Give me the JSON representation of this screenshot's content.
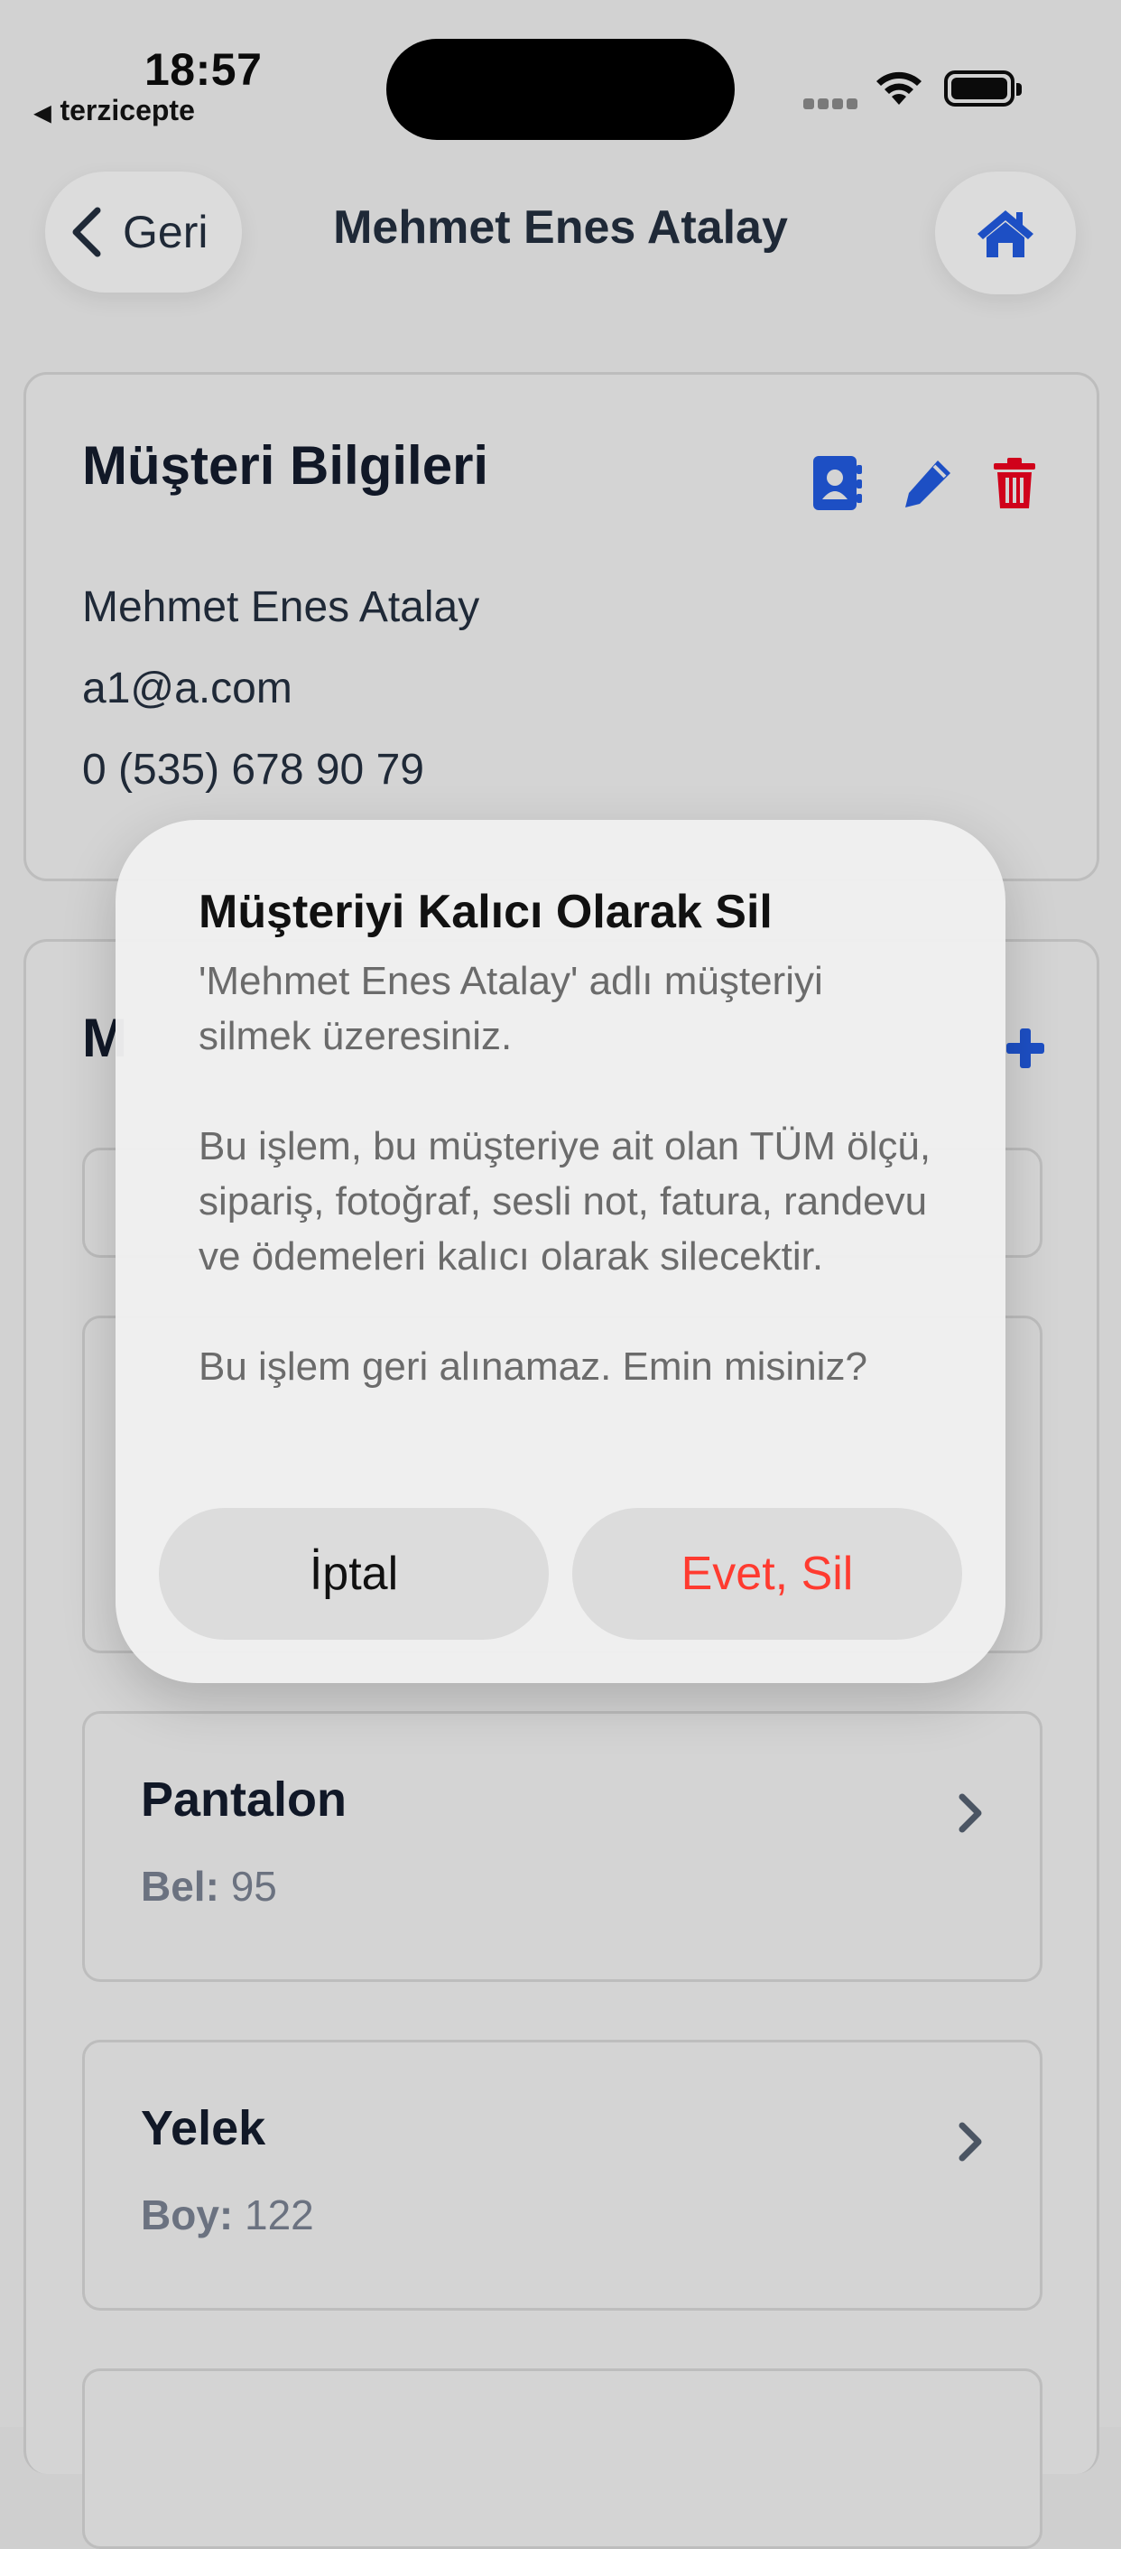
{
  "status_bar": {
    "time": "18:57",
    "back_app": "terzicepte"
  },
  "nav": {
    "back_label": "Geri",
    "title": "Mehmet Enes Atalay"
  },
  "customer_card": {
    "title": "Müşteri Bilgileri",
    "name": "Mehmet Enes Atalay",
    "email": "a1@a.com",
    "phone": "0 (535) 678 90 79"
  },
  "measurements": {
    "title_partial": "M",
    "items": [
      {
        "name": "Pantalon",
        "detail_label": "Bel:",
        "detail_value": "95"
      },
      {
        "name": "Yelek",
        "detail_label": "Boy:",
        "detail_value": "122"
      }
    ]
  },
  "alert": {
    "title": "Müşteriyi Kalıcı Olarak Sil",
    "message": "'Mehmet Enes Atalay' adlı müşteriyi silmek üzeresiniz.\n\nBu işlem, bu müşteriye ait olan TÜM ölçü, sipariş, fotoğraf, sesli not, fatura, randevu ve ödemeleri kalıcı olarak silecektir.\n\nBu işlem geri alınamaz. Emin misiniz?",
    "cancel_label": "İptal",
    "confirm_label": "Evet, Sil"
  },
  "colors": {
    "accent_blue": "#1d4fc4",
    "delete_red": "#d0021b",
    "destructive_text": "#ff3b30"
  }
}
